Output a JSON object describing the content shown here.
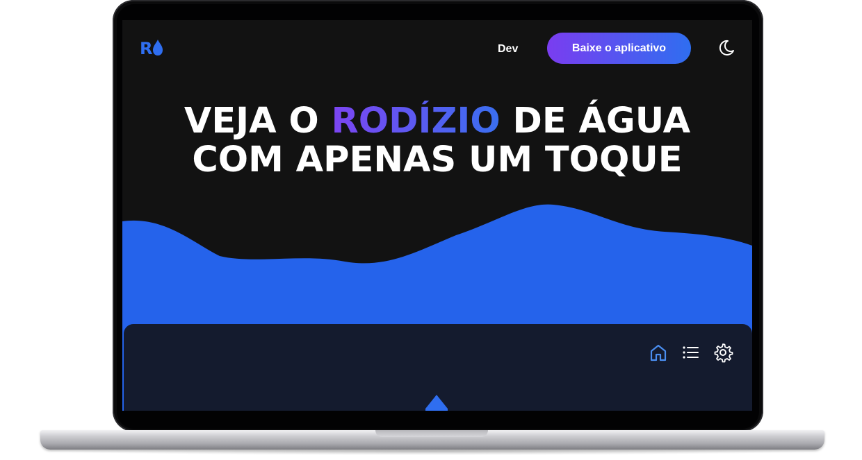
{
  "nav": {
    "logo_letter": "R",
    "dev_link": "Dev",
    "cta_label": "Baixe o aplicativo",
    "theme_icon": "moon-icon"
  },
  "hero": {
    "line1_before": "VEJA O",
    "line1_highlight": "RODÍZIO",
    "line1_after": "DE ÁGUA",
    "line2": "COM APENAS UM TOQUE"
  },
  "app_preview": {
    "icons": [
      "home-icon",
      "list-icon",
      "gear-icon"
    ],
    "active_icon": "home-icon"
  },
  "colors": {
    "screen_bg": "#121212",
    "wave": "#2563eb",
    "panel": "#141b2e",
    "accent_start": "#7a3df0",
    "accent_end": "#2f6ef0",
    "active_icon": "#4a8ef0"
  }
}
